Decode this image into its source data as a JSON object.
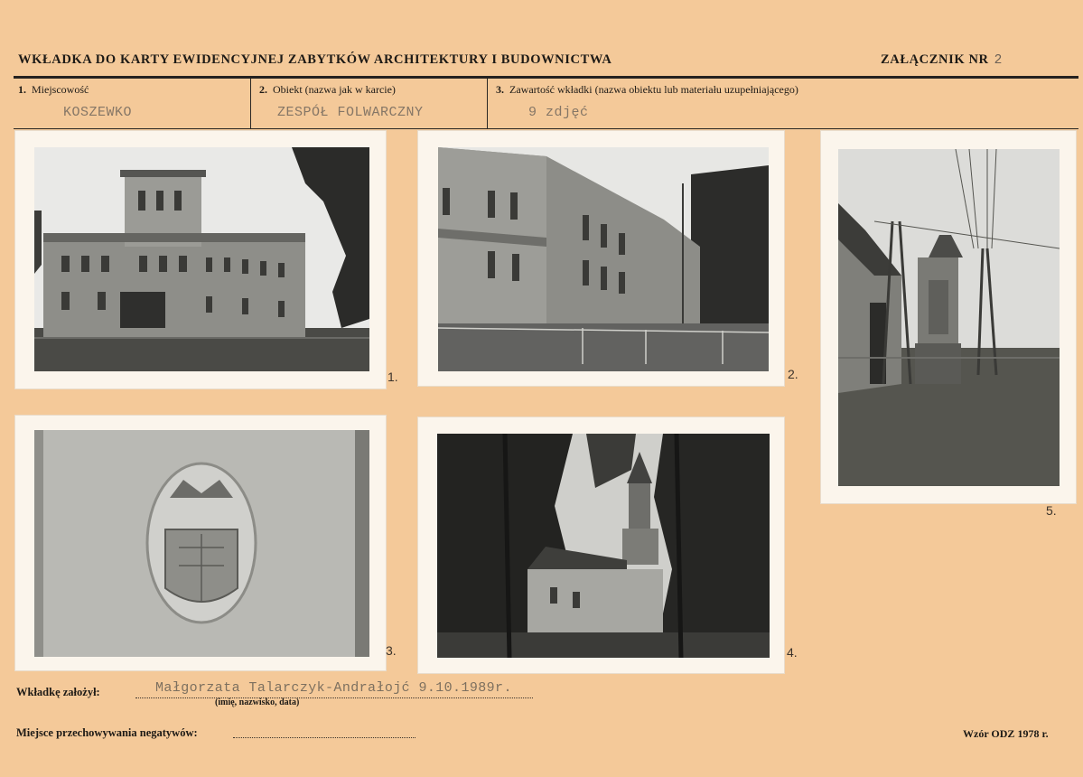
{
  "header": {
    "title": "WKŁADKA DO KARTY EWIDENCYJNEJ ZABYTKÓW  ARCHITEKTURY I BUDOWNICTWA",
    "attachment_label": "ZAŁĄCZNIK NR",
    "attachment_number": "2"
  },
  "fields": {
    "locality": {
      "num": "1.",
      "label": "Miejscowość",
      "value": "KOSZEWKO"
    },
    "object": {
      "num": "2.",
      "label": "Obiekt (nazwa jak w karcie)",
      "value": "ZESPÓŁ FOLWARCZNY"
    },
    "contents": {
      "num": "3.",
      "label": "Zawartość wkładki (nazwa obiektu lub materiału uzupełniającego)",
      "value": "9 zdjęć"
    }
  },
  "photos": [
    {
      "number": "1."
    },
    {
      "number": "2."
    },
    {
      "number": "3."
    },
    {
      "number": "4."
    },
    {
      "number": "5."
    }
  ],
  "footer": {
    "author_label": "Wkładkę  założył:",
    "author_value": "Małgorzata Talarczyk-Andrałojć 9.10.1989r.",
    "author_caption": "(imię, nazwisko, data)",
    "negatives_label": "Miejsce  przechowywania  negatywów:",
    "form_label": "Wzór ODZ 1978 r."
  }
}
